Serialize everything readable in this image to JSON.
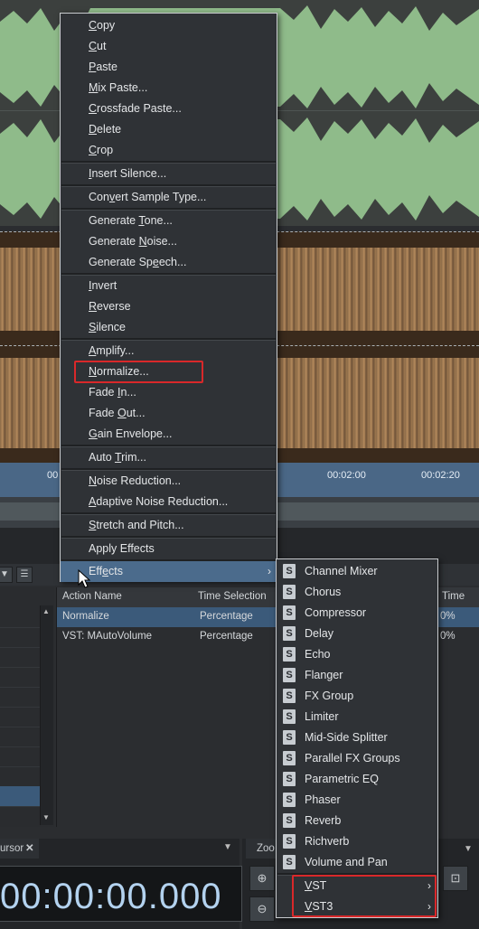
{
  "context_menu": {
    "items": [
      {
        "pre": "",
        "key": "C",
        "post": "opy"
      },
      {
        "pre": "",
        "key": "C",
        "post": "ut"
      },
      {
        "pre": "",
        "key": "P",
        "post": "aste"
      },
      {
        "pre": "",
        "key": "M",
        "post": "ix Paste..."
      },
      {
        "pre": "",
        "key": "C",
        "post": "rossfade Paste..."
      },
      {
        "pre": "",
        "key": "D",
        "post": "elete"
      },
      {
        "pre": "",
        "key": "C",
        "post": "rop"
      },
      {
        "pre": "",
        "key": "I",
        "post": "nsert Silence..."
      },
      {
        "pre": "Con",
        "key": "v",
        "post": "ert Sample Type..."
      },
      {
        "pre": "Generate ",
        "key": "T",
        "post": "one..."
      },
      {
        "pre": "Generate ",
        "key": "N",
        "post": "oise..."
      },
      {
        "pre": "Generate Sp",
        "key": "e",
        "post": "ech..."
      },
      {
        "pre": "",
        "key": "I",
        "post": "nvert"
      },
      {
        "pre": "",
        "key": "R",
        "post": "everse"
      },
      {
        "pre": "",
        "key": "S",
        "post": "ilence"
      },
      {
        "pre": "",
        "key": "A",
        "post": "mplify..."
      },
      {
        "pre": "",
        "key": "N",
        "post": "ormalize..."
      },
      {
        "pre": "Fade ",
        "key": "I",
        "post": "n..."
      },
      {
        "pre": "Fade ",
        "key": "O",
        "post": "ut..."
      },
      {
        "pre": "",
        "key": "G",
        "post": "ain Envelope..."
      },
      {
        "pre": "Auto ",
        "key": "T",
        "post": "rim..."
      },
      {
        "pre": "",
        "key": "N",
        "post": "oise Reduction..."
      },
      {
        "pre": "",
        "key": "A",
        "post": "daptive Noise Reduction..."
      },
      {
        "pre": "",
        "key": "S",
        "post": "tretch and Pitch..."
      },
      {
        "pre": "Apply Effects",
        "key": "",
        "post": ""
      },
      {
        "pre": "Eff",
        "key": "e",
        "post": "cts"
      }
    ]
  },
  "effects_submenu": {
    "badge": "S",
    "items": [
      "Channel Mixer",
      "Chorus",
      "Compressor",
      "Delay",
      "Echo",
      "Flanger",
      "FX Group",
      "Limiter",
      "Mid-Side Splitter",
      "Parallel FX Groups",
      "Parametric EQ",
      "Phaser",
      "Reverb",
      "Richverb",
      "Volume and Pan"
    ],
    "plugin_items": [
      {
        "pre": "",
        "key": "V",
        "post": "ST"
      },
      {
        "pre": "",
        "key": "V",
        "post": "ST3"
      }
    ]
  },
  "timeline": {
    "ticks": [
      "00",
      "00:02:00",
      "00:02:20"
    ]
  },
  "actions_table": {
    "headers": [
      "Action Name",
      "Time Selection",
      "Time"
    ],
    "rows": [
      {
        "name": "Normalize",
        "selection": "Percentage",
        "time": "0%"
      },
      {
        "name": "VST: MAutoVolume",
        "selection": "Percentage",
        "time": "0%"
      }
    ]
  },
  "cursor_panel": {
    "tab_label": "ursor",
    "time": "00:00:00.000"
  },
  "zoom_panel": {
    "tab_label": "Zoo"
  },
  "colors": {
    "menu_highlight": "#4b6b8c",
    "annotation_red": "#d9282a",
    "selected_row": "#3b5a7a"
  },
  "icons": [
    "close-icon",
    "chevron-down-icon",
    "list-icon",
    "zoom-in-icon",
    "zoom-out-icon",
    "zoom-selection-icon",
    "scroll-up-icon",
    "scroll-down-icon",
    "submenu-arrow-icon",
    "mouse-pointer-icon",
    "s-plugin-icon"
  ]
}
